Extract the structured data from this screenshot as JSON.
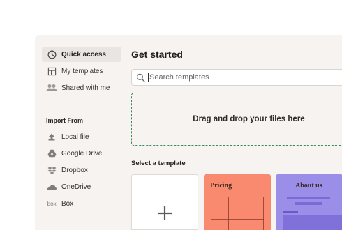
{
  "sidebar": {
    "items": [
      {
        "label": "Quick access",
        "icon": "clock-icon",
        "active": true
      },
      {
        "label": "My templates",
        "icon": "template-icon",
        "active": false
      },
      {
        "label": "Shared with me",
        "icon": "people-icon",
        "active": false
      }
    ],
    "import_heading": "Import From",
    "import_items": [
      {
        "label": "Local file",
        "icon": "upload-icon"
      },
      {
        "label": "Google Drive",
        "icon": "google-drive-icon"
      },
      {
        "label": "Dropbox",
        "icon": "dropbox-icon"
      },
      {
        "label": "OneDrive",
        "icon": "onedrive-icon"
      },
      {
        "label": "Box",
        "icon": "box-icon",
        "icon_text": "box"
      }
    ]
  },
  "main": {
    "title": "Get started",
    "search": {
      "placeholder": "Search templates"
    },
    "dropzone_text": "Drag and drop your files here",
    "select_label": "Select a template",
    "templates": [
      {
        "name": "blank",
        "title": ""
      },
      {
        "name": "pricing",
        "title": "Pricing"
      },
      {
        "name": "about",
        "title": "About us"
      }
    ]
  },
  "colors": {
    "accent_green": "#3a8a5c",
    "pricing_card": "#f98a6f",
    "about_card": "#9b8ee8",
    "panel_bg": "#f6f3f0"
  }
}
